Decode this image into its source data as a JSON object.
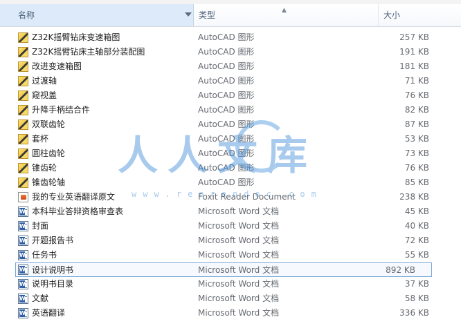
{
  "header": {
    "name_label": "名称",
    "type_label": "类型",
    "size_label": "大小"
  },
  "rows": [
    {
      "name": "Z32K摇臂钻床变速箱图",
      "type": "AutoCAD 图形",
      "size": "257 KB",
      "icon": "autocad-file-icon"
    },
    {
      "name": "Z32K摇臂钻床主轴部分装配图",
      "type": "AutoCAD 图形",
      "size": "191 KB",
      "icon": "autocad-file-icon"
    },
    {
      "name": "改进变速箱图",
      "type": "AutoCAD 图形",
      "size": "181 KB",
      "icon": "autocad-file-icon"
    },
    {
      "name": "过渡轴",
      "type": "AutoCAD 图形",
      "size": "71 KB",
      "icon": "autocad-file-icon"
    },
    {
      "name": "窥视盖",
      "type": "AutoCAD 图形",
      "size": "76 KB",
      "icon": "autocad-file-icon"
    },
    {
      "name": "升降手柄结合件",
      "type": "AutoCAD 图形",
      "size": "82 KB",
      "icon": "autocad-file-icon"
    },
    {
      "name": "双联齿轮",
      "type": "AutoCAD 图形",
      "size": "87 KB",
      "icon": "autocad-file-icon"
    },
    {
      "name": "套杯",
      "type": "AutoCAD 图形",
      "size": "53 KB",
      "icon": "autocad-file-icon"
    },
    {
      "name": "圆柱齿轮",
      "type": "AutoCAD 图形",
      "size": "73 KB",
      "icon": "autocad-file-icon"
    },
    {
      "name": "锥齿轮",
      "type": "AutoCAD 图形",
      "size": "76 KB",
      "icon": "autocad-file-icon"
    },
    {
      "name": "锥齿轮轴",
      "type": "AutoCAD 图形",
      "size": "85 KB",
      "icon": "autocad-file-icon"
    },
    {
      "name": "我的专业英语翻译原文",
      "type": "Foxit Reader Document",
      "size": "238 KB",
      "icon": "pdf-file-icon"
    },
    {
      "name": "本科毕业答辩资格审查表",
      "type": "Microsoft Word 文档",
      "size": "45 KB",
      "icon": "word-file-icon"
    },
    {
      "name": "封面",
      "type": "Microsoft Word 文档",
      "size": "40 KB",
      "icon": "word-file-icon"
    },
    {
      "name": "开题报告书",
      "type": "Microsoft Word 文档",
      "size": "72 KB",
      "icon": "word-file-icon"
    },
    {
      "name": "任务书",
      "type": "Microsoft Word 文档",
      "size": "55 KB",
      "icon": "word-file-icon"
    },
    {
      "name": "设计说明书",
      "type": "Microsoft Word 文档",
      "size": "892 KB",
      "icon": "word-file-icon"
    },
    {
      "name": "说明书目录",
      "type": "Microsoft Word 文档",
      "size": "37 KB",
      "icon": "word-file-icon"
    },
    {
      "name": "文献",
      "type": "Microsoft Word 文档",
      "size": "58 KB",
      "icon": "word-file-icon"
    },
    {
      "name": "英语翻译",
      "type": "Microsoft Word 文档",
      "size": "336 KB",
      "icon": "word-file-icon"
    }
  ],
  "selected_row": "设计说明书",
  "watermark": {
    "text": "人人文库",
    "url": "www.renrendoc.com"
  }
}
